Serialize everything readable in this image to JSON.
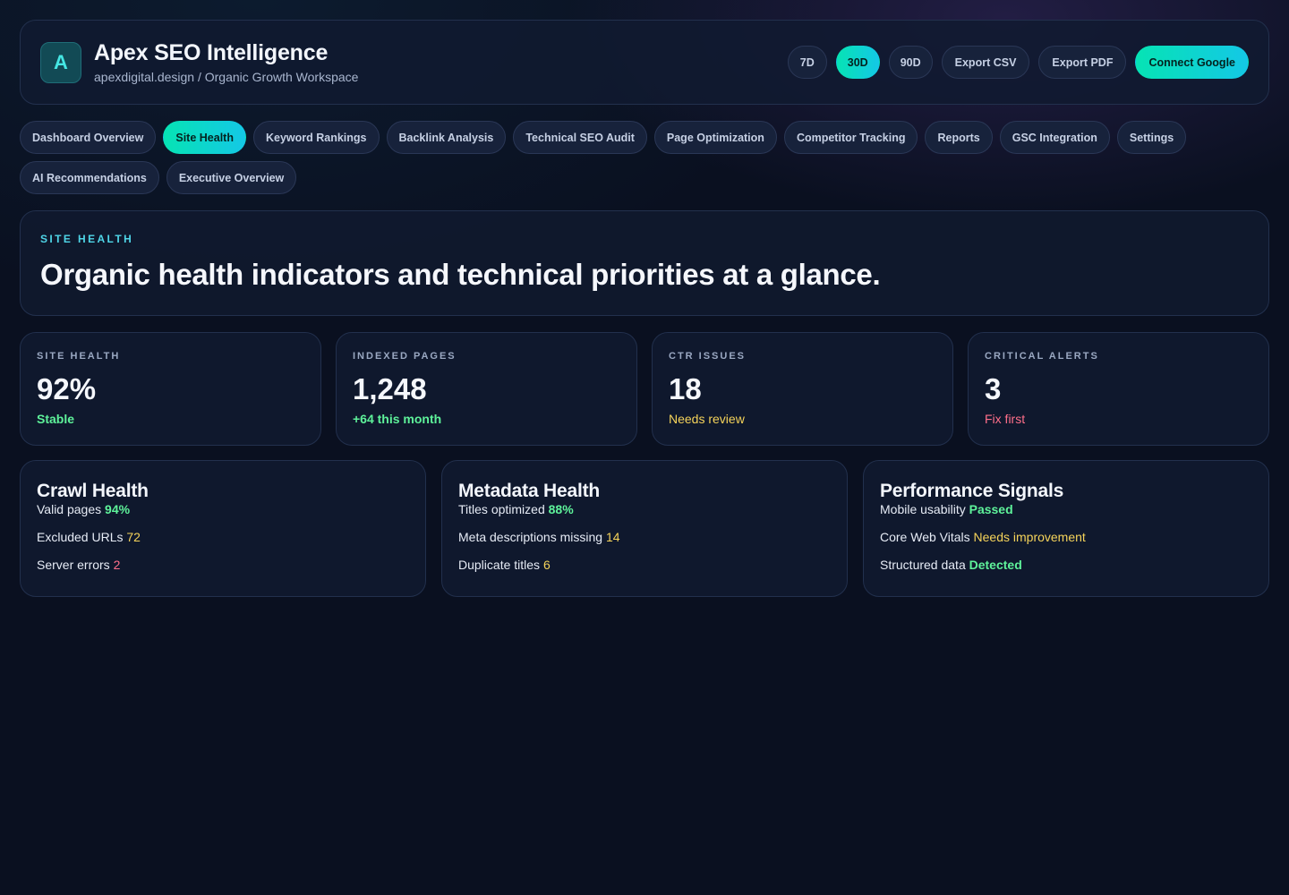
{
  "header": {
    "logo_letter": "A",
    "title": "Apex SEO Intelligence",
    "subtitle": "apexdigital.design / Organic Growth Workspace",
    "ranges": [
      "7D",
      "30D",
      "90D"
    ],
    "active_range": "30D",
    "export_csv": "Export CSV",
    "export_pdf": "Export PDF",
    "connect": "Connect Google"
  },
  "nav": {
    "items": [
      "Dashboard Overview",
      "Site Health",
      "Keyword Rankings",
      "Backlink Analysis",
      "Technical SEO Audit",
      "Page Optimization",
      "Competitor Tracking",
      "Reports",
      "GSC Integration",
      "Settings",
      "AI Recommendations",
      "Executive Overview"
    ],
    "active": "Site Health"
  },
  "hero": {
    "eyebrow": "SITE HEALTH",
    "title": "Organic health indicators and technical priorities at a glance."
  },
  "stats": [
    {
      "label": "SITE HEALTH",
      "value": "92%",
      "note": "Stable",
      "tone": "green",
      "bold": true
    },
    {
      "label": "INDEXED PAGES",
      "value": "1,248",
      "note": "+64 this month",
      "tone": "green",
      "bold": true
    },
    {
      "label": "CTR ISSUES",
      "value": "18",
      "note": "Needs review",
      "tone": "yellow",
      "bold": false
    },
    {
      "label": "CRITICAL ALERTS",
      "value": "3",
      "note": "Fix first",
      "tone": "red",
      "bold": false
    }
  ],
  "panels": [
    {
      "title": "Crawl Health",
      "rows": [
        {
          "label": "Valid pages",
          "value": "94%",
          "tone": "green",
          "bold": true
        },
        {
          "label": "Excluded URLs",
          "value": "72",
          "tone": "yellow",
          "bold": false
        },
        {
          "label": "Server errors",
          "value": "2",
          "tone": "red",
          "bold": false
        }
      ]
    },
    {
      "title": "Metadata Health",
      "rows": [
        {
          "label": "Titles optimized",
          "value": "88%",
          "tone": "green",
          "bold": true
        },
        {
          "label": "Meta descriptions missing",
          "value": "14",
          "tone": "yellow",
          "bold": false
        },
        {
          "label": "Duplicate titles",
          "value": "6",
          "tone": "yellow",
          "bold": false
        }
      ]
    },
    {
      "title": "Performance Signals",
      "rows": [
        {
          "label": "Mobile usability",
          "value": "Passed",
          "tone": "green",
          "bold": true
        },
        {
          "label": "Core Web Vitals",
          "value": "Needs improvement",
          "tone": "yellow",
          "bold": false
        },
        {
          "label": "Structured data",
          "value": "Detected",
          "tone": "green",
          "bold": true
        }
      ]
    }
  ],
  "colors": {
    "accent_start": "#06e3b4",
    "accent_end": "#14c8e6",
    "good": "#5ef29a",
    "warn": "#f5d35a",
    "bad": "#ff6f8a",
    "background": "#0a1020"
  }
}
